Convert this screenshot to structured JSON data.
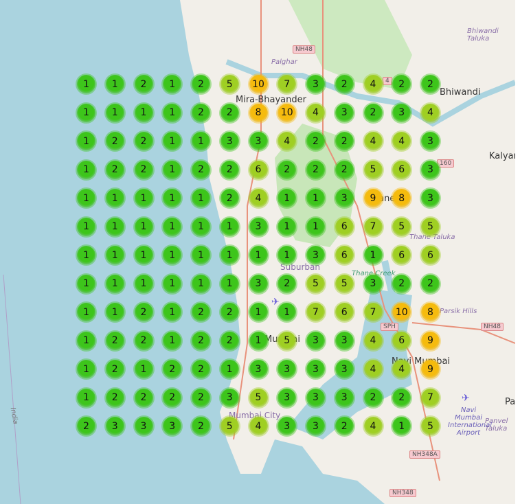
{
  "map": {
    "labels": {
      "mira": "Mira-Bhayander",
      "bhiwandi": "Bhiwandi",
      "kalyan": "Kalyan",
      "thane": "Thane",
      "suburban": "Suburban",
      "mumbai": "Mumbai",
      "navi": "Navi Mumbai",
      "city": "Mumbai City",
      "palghar": "Palghar",
      "bhiwandi_taluka": "Bhiwandi Taluka",
      "thane_taluka": "Thane Taluka",
      "parsik": "Parsik Hills",
      "panvel": "Panvel Taluka",
      "airport": "Navi Mumbai International Airport",
      "creek": "Thane Creek",
      "india": "India",
      "pa": "Pa"
    },
    "shields": {
      "nh48a": "NH48",
      "nh48b": "NH48",
      "nh348a": "NH348A",
      "nh348": "NH348",
      "sph": "SPH",
      "nh160": "160",
      "nh4": "4"
    }
  },
  "clusters": {
    "colors": {
      "low": "#3dc51b",
      "mid": "#9fcf23",
      "high": "#f5bb0e"
    },
    "rows": [
      [
        1,
        1,
        2,
        1,
        2,
        5,
        10,
        7,
        3,
        2,
        4,
        2,
        2
      ],
      [
        1,
        1,
        1,
        1,
        2,
        2,
        8,
        10,
        4,
        3,
        2,
        3,
        4
      ],
      [
        1,
        2,
        2,
        1,
        1,
        3,
        3,
        4,
        2,
        2,
        4,
        4,
        3
      ],
      [
        1,
        2,
        2,
        1,
        2,
        2,
        6,
        2,
        2,
        2,
        5,
        6,
        3
      ],
      [
        1,
        1,
        1,
        1,
        1,
        2,
        4,
        1,
        1,
        3,
        9,
        8,
        3
      ],
      [
        1,
        1,
        1,
        1,
        1,
        1,
        3,
        1,
        1,
        6,
        7,
        5,
        5
      ],
      [
        1,
        1,
        1,
        1,
        1,
        1,
        1,
        1,
        3,
        6,
        1,
        6,
        6
      ],
      [
        1,
        1,
        1,
        1,
        1,
        1,
        3,
        2,
        5,
        5,
        3,
        2,
        2
      ],
      [
        1,
        1,
        2,
        1,
        2,
        2,
        1,
        1,
        7,
        6,
        7,
        10,
        8
      ],
      [
        1,
        2,
        2,
        1,
        2,
        2,
        1,
        5,
        3,
        3,
        4,
        6,
        9
      ],
      [
        1,
        2,
        1,
        2,
        2,
        1,
        3,
        3,
        3,
        3,
        4,
        4,
        9
      ],
      [
        1,
        2,
        2,
        2,
        2,
        3,
        5,
        3,
        3,
        3,
        2,
        2,
        7
      ],
      [
        2,
        3,
        3,
        3,
        2,
        5,
        4,
        3,
        3,
        2,
        4,
        1,
        5
      ]
    ]
  }
}
